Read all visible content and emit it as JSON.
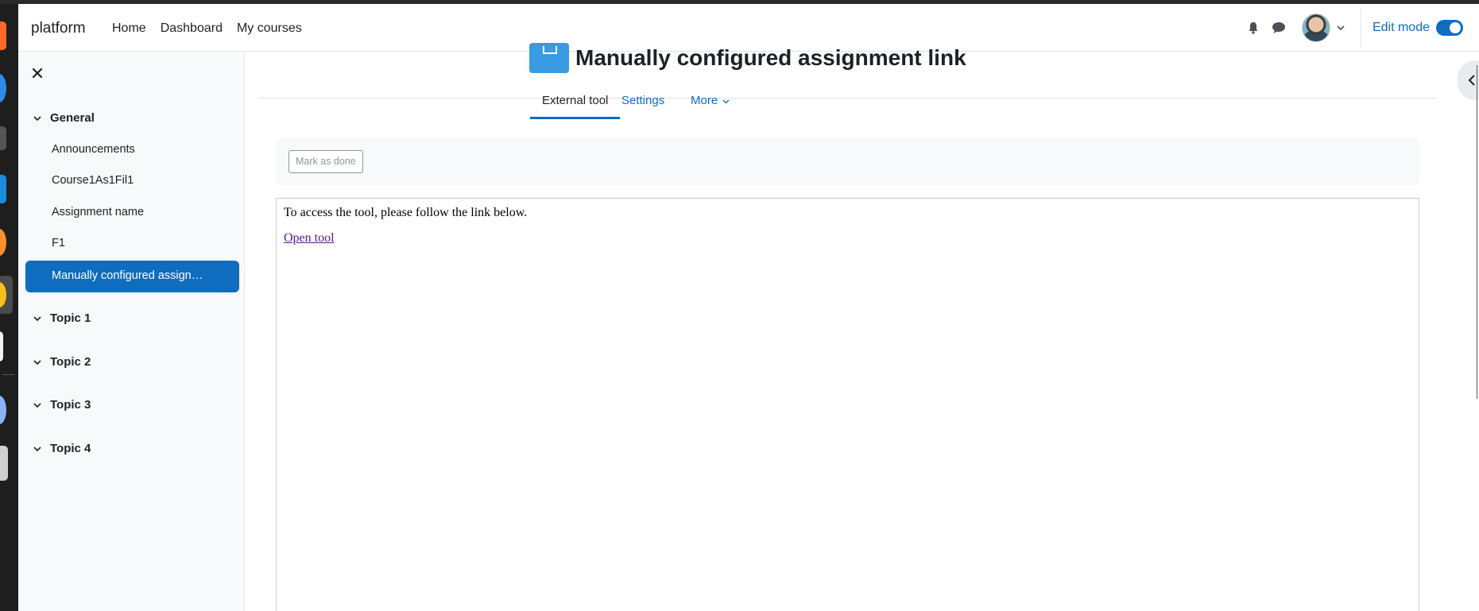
{
  "navbar": {
    "brand": "platform",
    "links": [
      "Home",
      "Dashboard",
      "My courses"
    ],
    "edit_mode_label": "Edit mode",
    "edit_mode_on": true,
    "icons": [
      "bell-icon",
      "chat-icon",
      "avatar",
      "chevron-down-icon"
    ]
  },
  "drawer": {
    "sections": [
      {
        "title": "General",
        "items": [
          "Announcements",
          "Course1As1Fil1",
          "Assignment name",
          "F1",
          "Manually configured assign…"
        ],
        "active_index": 4
      },
      {
        "title": "Topic 1",
        "items": []
      },
      {
        "title": "Topic 2",
        "items": []
      },
      {
        "title": "Topic 3",
        "items": []
      },
      {
        "title": "Topic 4",
        "items": []
      }
    ]
  },
  "main": {
    "title": "Manually configured assignment link",
    "tabs": [
      "External tool",
      "Settings",
      "More"
    ],
    "active_tab": 0,
    "mark_as_done": "Mark as done",
    "tool_text": "To access the tool, please follow the link below.",
    "tool_link": "Open tool"
  },
  "colors": {
    "accent": "#0f6cbf",
    "drawer_bg": "#f8f9fa",
    "visited_link": "#551a8b",
    "title_icon": "#399be2"
  }
}
